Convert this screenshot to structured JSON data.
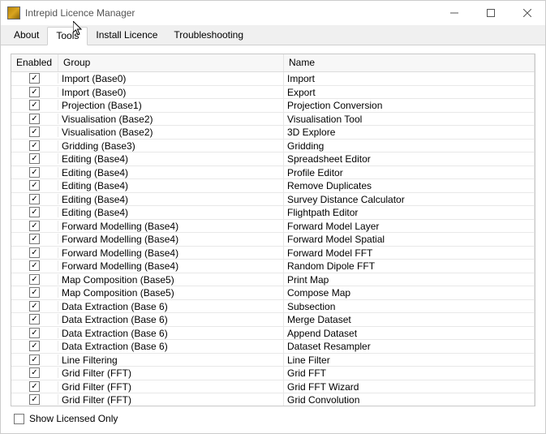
{
  "window": {
    "title": "Intrepid Licence Manager"
  },
  "tabs": {
    "items": [
      {
        "label": "About"
      },
      {
        "label": "Tools"
      },
      {
        "label": "Install Licence"
      },
      {
        "label": "Troubleshooting"
      }
    ],
    "active_index": 1
  },
  "columns": {
    "enabled": "Enabled",
    "group": "Group",
    "name": "Name"
  },
  "rows": [
    {
      "enabled": true,
      "group": "Import (Base0)",
      "name": "Import"
    },
    {
      "enabled": true,
      "group": "Import (Base0)",
      "name": "Export"
    },
    {
      "enabled": true,
      "group": "Projection (Base1)",
      "name": "Projection Conversion"
    },
    {
      "enabled": true,
      "group": "Visualisation (Base2)",
      "name": "Visualisation Tool"
    },
    {
      "enabled": true,
      "group": "Visualisation (Base2)",
      "name": "3D Explore"
    },
    {
      "enabled": true,
      "group": "Gridding (Base3)",
      "name": "Gridding"
    },
    {
      "enabled": true,
      "group": "Editing (Base4)",
      "name": "Spreadsheet Editor"
    },
    {
      "enabled": true,
      "group": "Editing (Base4)",
      "name": "Profile Editor"
    },
    {
      "enabled": true,
      "group": "Editing (Base4)",
      "name": "Remove Duplicates"
    },
    {
      "enabled": true,
      "group": "Editing (Base4)",
      "name": "Survey Distance Calculator"
    },
    {
      "enabled": true,
      "group": "Editing (Base4)",
      "name": "Flightpath Editor"
    },
    {
      "enabled": true,
      "group": "Forward Modelling (Base4)",
      "name": "Forward Model Layer"
    },
    {
      "enabled": true,
      "group": "Forward Modelling (Base4)",
      "name": "Forward Model Spatial"
    },
    {
      "enabled": true,
      "group": "Forward Modelling (Base4)",
      "name": "Forward Model FFT"
    },
    {
      "enabled": true,
      "group": "Forward Modelling (Base4)",
      "name": "Random Dipole FFT"
    },
    {
      "enabled": true,
      "group": "Map Composition (Base5)",
      "name": "Print Map"
    },
    {
      "enabled": true,
      "group": "Map Composition (Base5)",
      "name": "Compose Map"
    },
    {
      "enabled": true,
      "group": "Data Extraction (Base 6)",
      "name": "Subsection"
    },
    {
      "enabled": true,
      "group": "Data Extraction (Base 6)",
      "name": "Merge Dataset"
    },
    {
      "enabled": true,
      "group": "Data Extraction (Base 6)",
      "name": "Append Dataset"
    },
    {
      "enabled": true,
      "group": "Data Extraction (Base 6)",
      "name": "Dataset Resampler"
    },
    {
      "enabled": true,
      "group": "Line Filtering",
      "name": "Line Filter"
    },
    {
      "enabled": true,
      "group": "Grid Filter (FFT)",
      "name": "Grid FFT"
    },
    {
      "enabled": true,
      "group": "Grid Filter (FFT)",
      "name": "Grid FFT Wizard"
    },
    {
      "enabled": true,
      "group": "Grid Filter (FFT)",
      "name": "Grid Convolution"
    }
  ],
  "footer": {
    "show_licensed_only_label": "Show Licensed Only",
    "show_licensed_only_checked": false
  }
}
